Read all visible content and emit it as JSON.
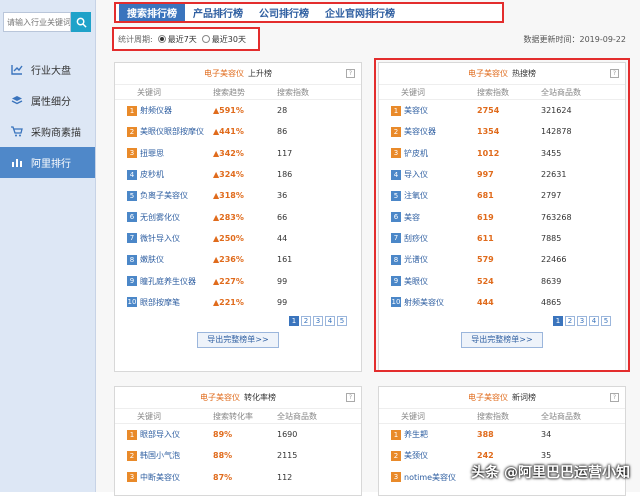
{
  "search": {
    "placeholder": "请输入行业关键词"
  },
  "nav": [
    {
      "label": "行业大盘",
      "icon": "chart-line-icon"
    },
    {
      "label": "属性细分",
      "icon": "layers-icon"
    },
    {
      "label": "采购商素描",
      "icon": "cart-icon"
    },
    {
      "label": "阿里排行",
      "icon": "bar-chart-icon",
      "active": true
    }
  ],
  "tabs": [
    {
      "label": "搜索排行榜",
      "active": true
    },
    {
      "label": "产品排行榜"
    },
    {
      "label": "公司排行榜"
    },
    {
      "label": "企业官网排行榜"
    }
  ],
  "period": {
    "label": "统计周期:",
    "opt1": "最近7天",
    "opt2": "最近30天"
  },
  "updated": "数据更新时间：2019-09-22",
  "rising": {
    "category": "电子美容仪",
    "title": "上升榜",
    "headers": [
      "关键词",
      "搜索趋势",
      "搜索指数"
    ],
    "rows": [
      [
        "射频仪器",
        "591%",
        "28"
      ],
      [
        "美眼仪眼部按摩仪",
        "441%",
        "86"
      ],
      [
        "扭罪思",
        "342%",
        "117"
      ],
      [
        "皮秒机",
        "324%",
        "186"
      ],
      [
        "负离子美容仪",
        "318%",
        "36"
      ],
      [
        "无创雾化仪",
        "283%",
        "66"
      ],
      [
        "微针导入仪",
        "250%",
        "44"
      ],
      [
        "嫩肤仪",
        "236%",
        "161"
      ],
      [
        "瞳孔庭养生仪器",
        "227%",
        "99"
      ],
      [
        "眼部按摩笔",
        "221%",
        "99"
      ]
    ],
    "pages": [
      "1",
      "2",
      "3",
      "4",
      "5"
    ],
    "export": "导出完整榜单>>"
  },
  "hot": {
    "category": "电子美容仪",
    "title": "热搜榜",
    "headers": [
      "关键词",
      "搜索指数",
      "全站商品数"
    ],
    "rows": [
      [
        "美容仪",
        "2754",
        "321624"
      ],
      [
        "美容仪器",
        "1354",
        "142878"
      ],
      [
        "铲皮机",
        "1012",
        "3455"
      ],
      [
        "导入仪",
        "997",
        "22631"
      ],
      [
        "注氧仪",
        "681",
        "2797"
      ],
      [
        "美容",
        "619",
        "763268"
      ],
      [
        "刮痧仪",
        "611",
        "7885"
      ],
      [
        "光谱仪",
        "579",
        "22466"
      ],
      [
        "美眼仪",
        "524",
        "8639"
      ],
      [
        "射频美容仪",
        "444",
        "4865"
      ]
    ],
    "pages": [
      "1",
      "2",
      "3",
      "4",
      "5"
    ],
    "export": "导出完整榜单>>"
  },
  "conversion": {
    "category": "电子美容仪",
    "title": "转化率榜",
    "headers": [
      "关键词",
      "搜索转化率",
      "全站商品数"
    ],
    "rows": [
      [
        "眼部导入仪",
        "89%",
        "1690"
      ],
      [
        "韩国小气泡",
        "88%",
        "2115"
      ],
      [
        "中断美容仪",
        "87%",
        "112"
      ]
    ]
  },
  "newwords": {
    "category": "电子美容仪",
    "title": "新词榜",
    "headers": [
      "关键词",
      "搜索指数",
      "全站商品数"
    ],
    "rows": [
      [
        "养生耙",
        "388",
        "34"
      ],
      [
        "美颈仪",
        "242",
        "35"
      ],
      [
        "notime美容仪",
        "",
        ""
      ]
    ]
  },
  "watermark": "头条 @阿里巴巴运营小知"
}
